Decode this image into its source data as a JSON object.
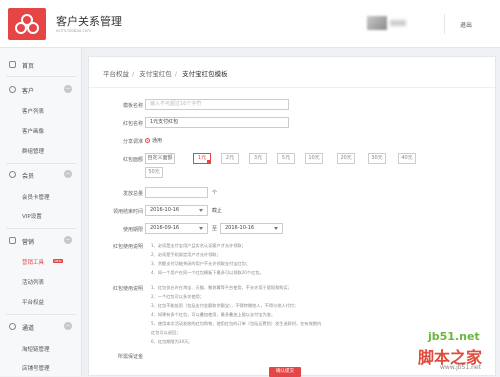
{
  "header": {
    "app_title": "客户关系管理",
    "app_subtitle": "ecrm.taobao.com",
    "logout": "退出"
  },
  "sidebar": {
    "home": "首页",
    "customer": {
      "title": "客户",
      "items": [
        "客户列表",
        "客户画像",
        "群组管理"
      ]
    },
    "member": {
      "title": "会员",
      "items": [
        "会员卡管理",
        "VIP设置"
      ]
    },
    "marketing": {
      "title": "营销",
      "items": [
        "营销工具",
        "活动列表",
        "平台权益"
      ],
      "badge": "NEW"
    },
    "channel": {
      "title": "通道",
      "items": [
        "淘短链管理",
        "店铺号管理"
      ]
    }
  },
  "breadcrumb": [
    "平台权益",
    "支付宝红包",
    "支付宝红包模板"
  ],
  "form": {
    "template_name": {
      "label": "模板名称",
      "placeholder": "输入不可超过16个字符"
    },
    "redpacket_name": {
      "label": "红包名称",
      "value": "1元支付红包"
    },
    "distribution": {
      "label": "分享调准",
      "option": "通用"
    },
    "denomination": {
      "label": "红包面额",
      "custom": "自定义面额",
      "options": [
        "1元",
        "2元",
        "3元",
        "5元",
        "10元",
        "20元",
        "30元",
        "40元",
        "50元"
      ],
      "selected": "1元"
    },
    "quantity": {
      "label": "发放总量",
      "unit": "个"
    },
    "send_end": {
      "label": "领用结束时间",
      "value": "2016-10-16",
      "suffix": "截止"
    },
    "use_period": {
      "label": "使用期限",
      "start": "2016-09-16",
      "to": "至",
      "end": "2016-10-16"
    },
    "rules_label": "红包使用说明",
    "rules": [
      "1、必须是支付宝用户且实名认证客户才允许领取；",
      "2、必须是手机绑定用户才允许领取；",
      "3、余额支付功能关闭的用户不允许领取支付宝红包；",
      "4、同一个用户在同一个红包模板下最多可以领取20个红包。"
    ],
    "usage_label": "红包使用说明",
    "usage": [
      "1、红包仅允许在淘宝、天猫、聚划算等平台使用，不允许用于提现和购买；",
      "2、一个红包可以多次使用；",
      "3、红包不能抵用（包括支付金额和余额宝），不得转赠他人，不得与他人代付；",
      "4、如果有多个红包，可以叠加使用，最多叠加上限以支付宝为准；",
      "5、使用本次活动发放的红包购物，使用红包的订单（包括运费险）发生退款时，在有效期内",
      "红包可以退回；",
      "6、红包期限为30天。"
    ],
    "guarantee_label": "所需保证金",
    "submit": "确认提交"
  },
  "watermark": {
    "site": "jb51.net",
    "brand": "脚本之家",
    "sub": "www.jb51.net"
  },
  "colors": {
    "accent": "#e64545",
    "sidebar_bg": "#f7f8fa",
    "panel_bg": "#ffffff"
  }
}
